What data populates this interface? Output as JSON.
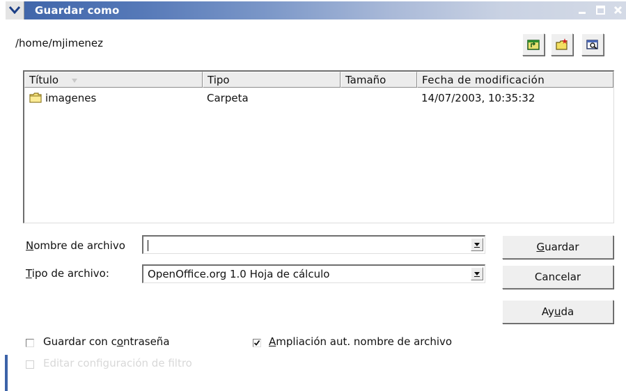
{
  "window": {
    "title": "Guardar como",
    "current_path": "/home/mjimenez"
  },
  "toolbar": {
    "icons": [
      "folder-up-icon",
      "new-folder-icon",
      "browse-icon"
    ]
  },
  "file_list": {
    "columns": [
      "Título",
      "Tipo",
      "Tamaño",
      "Fecha de modificación"
    ],
    "rows": [
      {
        "name": "imagenes",
        "type": "Carpeta",
        "size": "",
        "modified": "14/07/2003, 10:35:32"
      }
    ]
  },
  "form": {
    "filename_label": "Nombre de archivo",
    "filename_value": "",
    "filetype_label": "Tipo de archivo:",
    "filetype_value": "OpenOffice.org 1.0 Hoja de cálculo"
  },
  "buttons": {
    "save": "Guardar",
    "cancel": "Cancelar",
    "help": "Ayuda"
  },
  "options": {
    "password_label": "Guardar con contraseña",
    "password_checked": false,
    "extension_label": "Ampliación aut. nombre de archivo",
    "extension_checked": true,
    "filter_label": "Editar configuración de filtro",
    "filter_checked": false,
    "filter_disabled": true
  },
  "colors": {
    "titlebar_start": "#3d63a8",
    "titlebar_end": "#d4dae6"
  }
}
